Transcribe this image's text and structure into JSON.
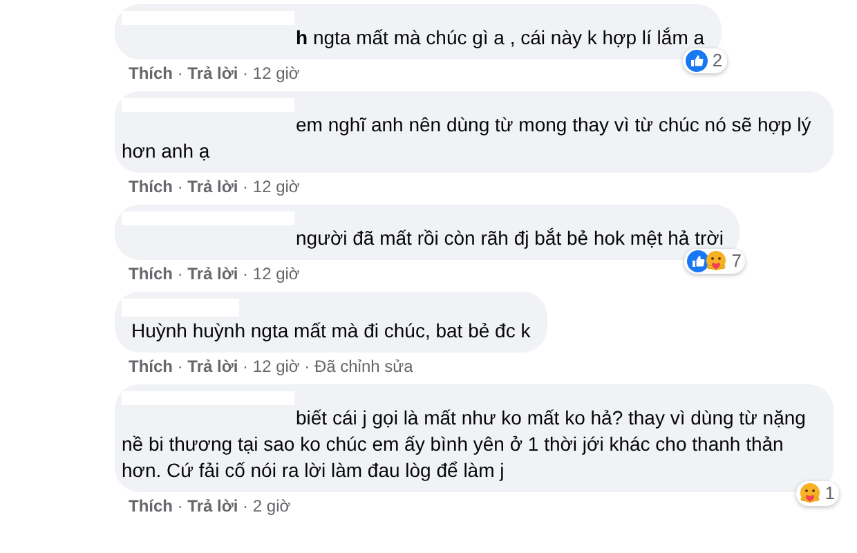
{
  "separator": "·",
  "comments": [
    {
      "kind": "inline",
      "text": "**h** ngta mất mà chúc gì a , cái này k hợp lí lắm a",
      "actions": [
        "Thích",
        "Trả lời"
      ],
      "time": "12 giờ",
      "reactions": [
        {
          "kind": "like"
        }
      ],
      "reaction_count": "2"
    },
    {
      "kind": "inline",
      "text": "em nghĩ anh nên dùng từ mong thay vì từ chúc nó sẽ hợp lý hơn anh ạ",
      "actions": [
        "Thích",
        "Trả lời"
      ],
      "time": "12 giờ"
    },
    {
      "kind": "inline",
      "text": "người đã mất rồi còn rãh đj bắt bẻ hok mệt hả trời",
      "actions": [
        "Thích",
        "Trả lời"
      ],
      "time": "12 giờ",
      "reactions": [
        {
          "kind": "like"
        },
        {
          "kind": "care"
        }
      ],
      "reaction_count": "7"
    },
    {
      "kind": "above",
      "text": "Huỳnh huỳnh ngta mất mà đi chúc, bat bẻ đc k",
      "actions": [
        "Thích",
        "Trả lời"
      ],
      "time": "12 giờ",
      "edited": "Đã chỉnh sửa"
    },
    {
      "kind": "inline",
      "text": "biết cái j gọi là mất như ko mất ko hả? thay vì dùng từ nặng nề bi thương tại sao ko chúc em ấy bình yên ở 1 thời jới khác cho thanh thản hơn. Cứ fải cố nói ra lời làm đau lòg để làm j",
      "actions": [
        "Thích",
        "Trả lời"
      ],
      "time": "2 giờ",
      "reactions": [
        {
          "kind": "care"
        }
      ],
      "reaction_count": "1"
    }
  ]
}
